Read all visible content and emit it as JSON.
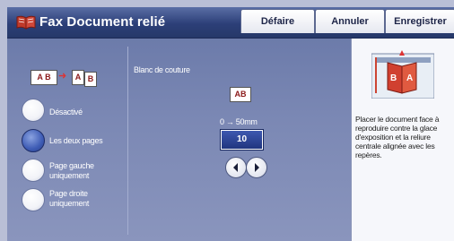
{
  "header": {
    "title": "Fax Document relié",
    "buttons": {
      "undo": "Défaire",
      "cancel": "Annuler",
      "save": "Enregistrer"
    }
  },
  "options": {
    "off": "Désactivé",
    "both_pages": "Les deux pages",
    "left_page": "Page gauche uniquement",
    "right_page": "Page droite uniquement",
    "selected": "both_pages"
  },
  "edge_erase": {
    "label": "Blanc de couture",
    "range": "0 → 50mm",
    "value": "10"
  },
  "icons": {
    "book_left": "A",
    "book_right": "B",
    "source": "AB",
    "scan_left": "A",
    "scan_right": "B",
    "preview_left": "B",
    "preview_right": "A"
  },
  "instructions": "Placer le document face à reproduire contre la glace d'exposition et la reliure centrale alignée avec les repères.",
  "colors": {
    "header": "#2c3f78",
    "accent_selected": "#3e5cb5",
    "panel": "#7b88b4"
  }
}
